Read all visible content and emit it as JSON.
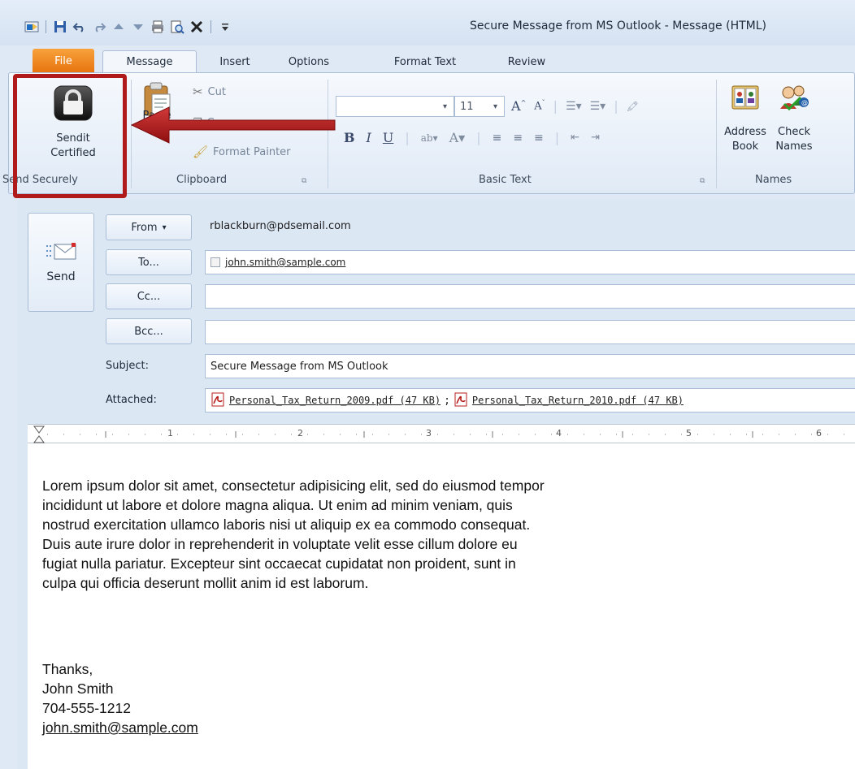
{
  "window": {
    "title": "Secure Message from MS Outlook  -  Message (HTML)"
  },
  "tabs": [
    {
      "label": "File"
    },
    {
      "label": "Message"
    },
    {
      "label": "Insert"
    },
    {
      "label": "Options"
    },
    {
      "label": "Format Text"
    },
    {
      "label": "Review"
    }
  ],
  "ribbon": {
    "sendit": {
      "line1": "Sendit",
      "line2": "Certified",
      "group": "Send Securely"
    },
    "clipboard": {
      "paste": "Paste",
      "cut": "Cut",
      "copy": "Copy",
      "format_painter": "Format Painter",
      "group": "Clipboard"
    },
    "basic_text": {
      "font_size": "11",
      "group": "Basic Text"
    },
    "names": {
      "address_book_1": "Address",
      "address_book_2": "Book",
      "check_names_1": "Check",
      "check_names_2": "Names",
      "group": "Names"
    }
  },
  "compose": {
    "send_label": "Send",
    "from_label": "From",
    "from_value": "rblackburn@pdsemail.com",
    "to_label": "To...",
    "to_value": "john.smith@sample.com",
    "cc_label": "Cc...",
    "bcc_label": "Bcc...",
    "subject_label": "Subject:",
    "subject_value": "Secure Message from MS Outlook",
    "attached_label": "Attached:",
    "attachments": [
      {
        "name": "Personal_Tax_Return_2009.pdf (47 KB)"
      },
      {
        "name": "Personal_Tax_Return_2010.pdf (47 KB)"
      }
    ]
  },
  "ruler": [
    "1",
    "2",
    "3",
    "4",
    "5",
    "6"
  ],
  "body": {
    "paragraph": "Lorem ipsum dolor sit amet, consectetur adipisicing elit, sed do eiusmod tempor\nincididunt ut labore et dolore magna aliqua. Ut enim ad minim veniam, quis\nnostrud exercitation ullamco laboris nisi ut aliquip ex ea commodo consequat.\nDuis aute irure dolor in reprehenderit in voluptate velit esse cillum dolore eu\nfugiat nulla pariatur. Excepteur sint occaecat cupidatat non proident, sunt in\nculpa qui officia deserunt mollit anim id est laborum.",
    "signoff": "Thanks,",
    "name": "John Smith",
    "phone": "704-555-1212",
    "email": "john.smith@sample.com"
  },
  "colors": {
    "highlight": "#b11a1a",
    "file_tab": "#e8730d",
    "ribbon_border": "#a9bdd6"
  }
}
